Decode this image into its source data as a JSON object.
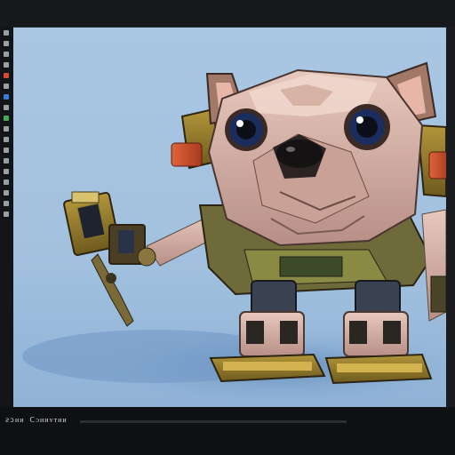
{
  "status": {
    "text": "ꙅɔᴎᴎ ᑕᴐᴎᴎᴠᴛᴎᴎ"
  },
  "toolbar": {
    "icons": [
      "square-icon",
      "square-icon",
      "pin-icon",
      "square-icon",
      "record-icon",
      "circle-icon",
      "square-icon"
    ]
  },
  "tools": {
    "icons": [
      "select-icon",
      "move-icon",
      "rotate-icon",
      "scale-icon",
      "brush-icon",
      "eraser-icon",
      "color-red-icon",
      "color-blue-icon",
      "color-green-icon",
      "layer-icon"
    ]
  },
  "viewport": {
    "content": "3d-robot-pug-render",
    "background": "#a9c7e3"
  },
  "colors": {
    "chrome": "#121316",
    "accent": "#e6b52b"
  }
}
